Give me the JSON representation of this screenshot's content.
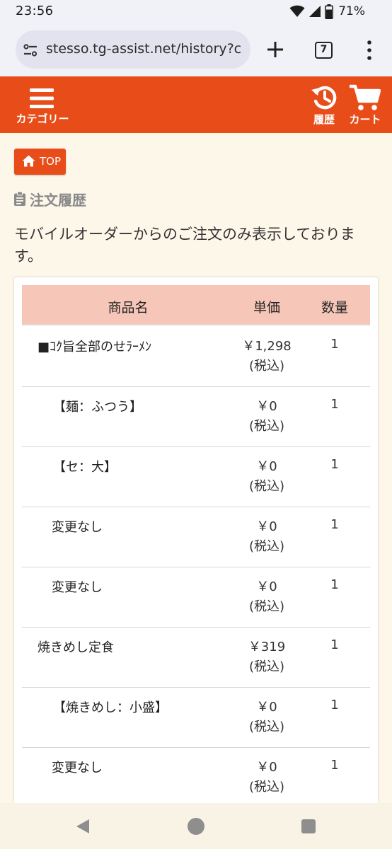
{
  "status_bar": {
    "time": "23:56",
    "battery": "71%",
    "icons": [
      "wifi-icon",
      "signal-icon",
      "battery-icon"
    ]
  },
  "browser": {
    "url": "stesso.tg-assist.net/history?c",
    "tab_count": "7",
    "icons": [
      "site-settings-icon",
      "plus-icon",
      "tabs-icon",
      "more-vert-icon"
    ]
  },
  "header": {
    "menu_label": "カテゴリー",
    "history_label": "履歴",
    "cart_label": "カート",
    "brand_color": "#e84c19"
  },
  "page": {
    "top_button": "TOP",
    "section_title": "注文履歴",
    "notice": "モバイルオーダーからのご注文のみ表示しております。"
  },
  "table": {
    "header_color": "#f6c6b9",
    "columns": [
      "商品名",
      "単価",
      "数量"
    ],
    "rows": [
      {
        "name": "■ｺｸ旨全部のせﾗｰﾒﾝ",
        "price": "￥1,298",
        "tax": "(税込)",
        "qty": "1",
        "level": 1
      },
      {
        "name": "【麺：ふつう】",
        "price": "￥0",
        "tax": "(税込)",
        "qty": "1",
        "level": 2
      },
      {
        "name": "【セ：大】",
        "price": "￥0",
        "tax": "(税込)",
        "qty": "1",
        "level": 2
      },
      {
        "name": "変更なし",
        "price": "￥0",
        "tax": "(税込)",
        "qty": "1",
        "level": 3
      },
      {
        "name": "変更なし",
        "price": "￥0",
        "tax": "(税込)",
        "qty": "1",
        "level": 3
      },
      {
        "name": "焼きめし定食",
        "price": "￥319",
        "tax": "(税込)",
        "qty": "1",
        "level": 1
      },
      {
        "name": "【焼きめし：小盛】",
        "price": "￥0",
        "tax": "(税込)",
        "qty": "1",
        "level": 2
      },
      {
        "name": "変更なし",
        "price": "￥0",
        "tax": "(税込)",
        "qty": "1",
        "level": 3
      }
    ]
  },
  "nav_bar": {
    "icons": [
      "back-icon",
      "home-icon",
      "recents-icon"
    ]
  }
}
